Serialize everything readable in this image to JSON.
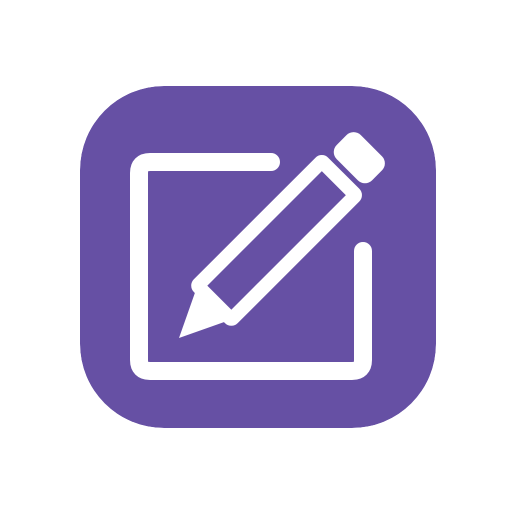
{
  "icon": {
    "name": "edit-icon",
    "glyph": "pencil-on-square-icon",
    "colors": {
      "background": "#6650A4",
      "foreground": "#FFFFFF",
      "page": "#FFFFFF"
    }
  }
}
